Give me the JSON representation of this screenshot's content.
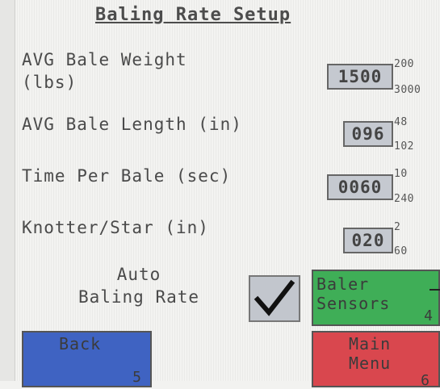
{
  "title": "Baling Rate Setup",
  "fields": [
    {
      "label": "AVG Bale Weight\n(lbs)",
      "value": "1500",
      "min": "200",
      "max": "3000"
    },
    {
      "label": "AVG Bale Length (in)",
      "value": "096",
      "min": "48",
      "max": "102"
    },
    {
      "label": "Time Per Bale (sec)",
      "value": "0060",
      "min": "10",
      "max": "240"
    },
    {
      "label": "Knotter/Star (in)",
      "value": "020",
      "min": "2",
      "max": "60"
    }
  ],
  "auto_baling_rate": {
    "label": "Auto\nBaling Rate",
    "checked": true
  },
  "buttons": {
    "baler_sensors": {
      "label": "Baler\nSensors",
      "number": "4",
      "color": "#3fae57"
    },
    "back": {
      "label": "Back",
      "number": "5",
      "color": "#3f63c2"
    },
    "main_menu": {
      "label": "Main\nMenu",
      "number": "6",
      "color": "#d9474e"
    }
  }
}
